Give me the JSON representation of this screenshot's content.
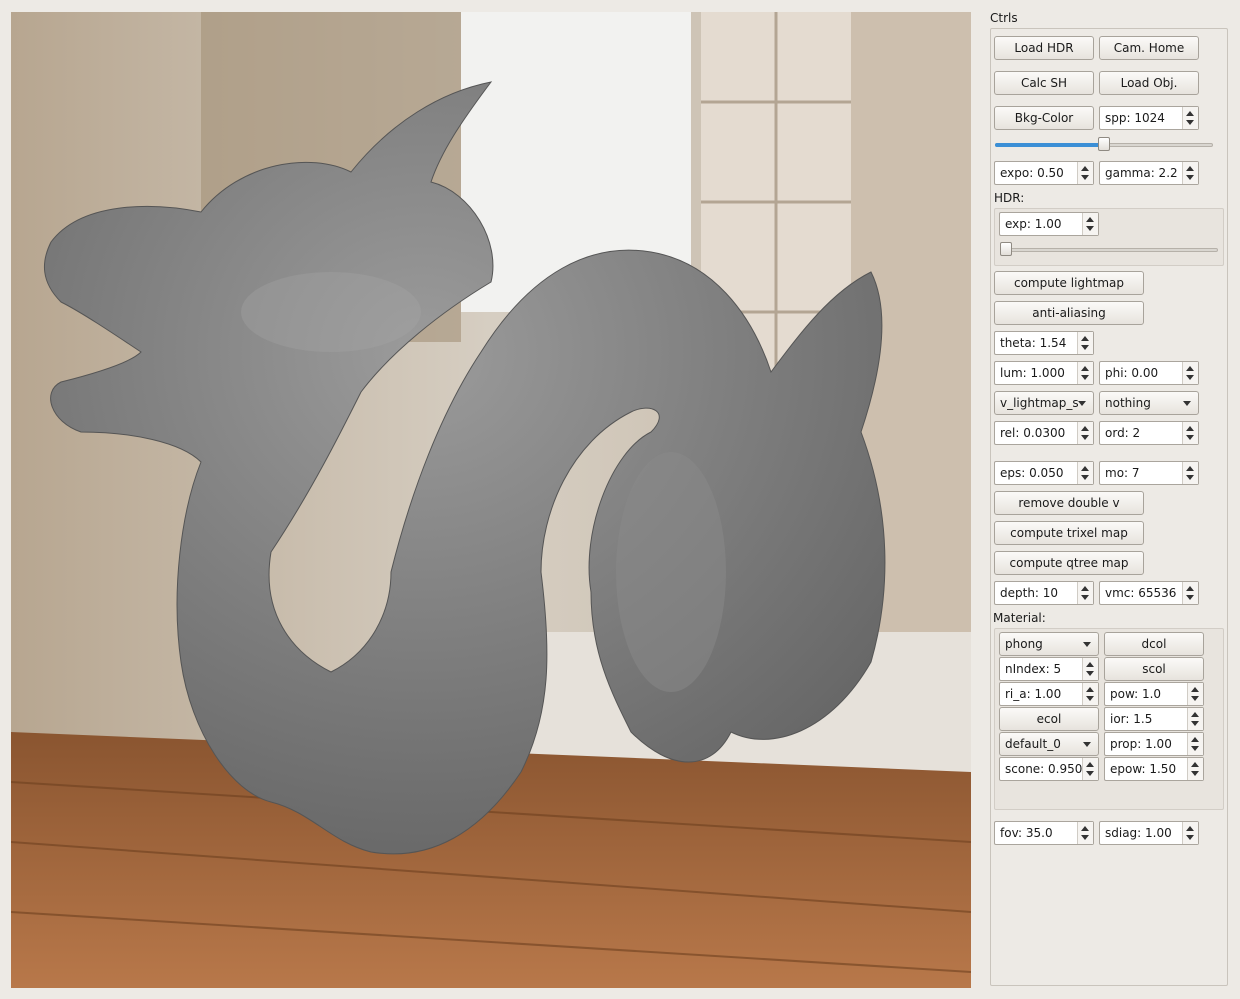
{
  "panel": {
    "title": "Ctrls",
    "buttons": {
      "load_hdr": "Load HDR",
      "cam_home": "Cam. Home",
      "calc_sh": "Calc SH",
      "load_obj": "Load Obj.",
      "bkg_color": "Bkg-Color",
      "compute_lightmap": "compute lightmap",
      "anti_aliasing": "anti-aliasing",
      "remove_double_v": "remove double v",
      "compute_trixel_map": "compute trixel map",
      "compute_qtree_map": "compute qtree map"
    },
    "spp": "spp: 1024",
    "spp_slider_fraction": 0.5,
    "expo": "expo: 0.50",
    "gamma": "gamma: 2.2",
    "hdr_label": "HDR:",
    "hdr_exp": "exp: 1.00",
    "hdr_slider_fraction": 0.0,
    "theta": "theta: 1.54",
    "lum": "lum: 1.000",
    "phi": "phi: 0.00",
    "combo_lightmap": "v_lightmap_s",
    "combo_nothing": "nothing",
    "rel": "rel: 0.0300",
    "ord": "ord: 2",
    "eps": "eps: 0.050",
    "mo": "mo: 7",
    "depth": "depth: 10",
    "vmc": "vmc: 65536",
    "material_label": "Material:",
    "material": {
      "shader": "phong",
      "dcol": "dcol",
      "nindex": "nIndex: 5",
      "scol": "scol",
      "ri_a": "ri_a: 1.00",
      "pow": "pow: 1.0",
      "ecol": "ecol",
      "ior": "ior: 1.5",
      "preset": "default_0",
      "prop": "prop: 1.00",
      "scone": "scone: 0.950",
      "epow": "epow: 1.50"
    },
    "fov": "fov: 35.0",
    "sdiag": "sdiag: 1.00"
  }
}
